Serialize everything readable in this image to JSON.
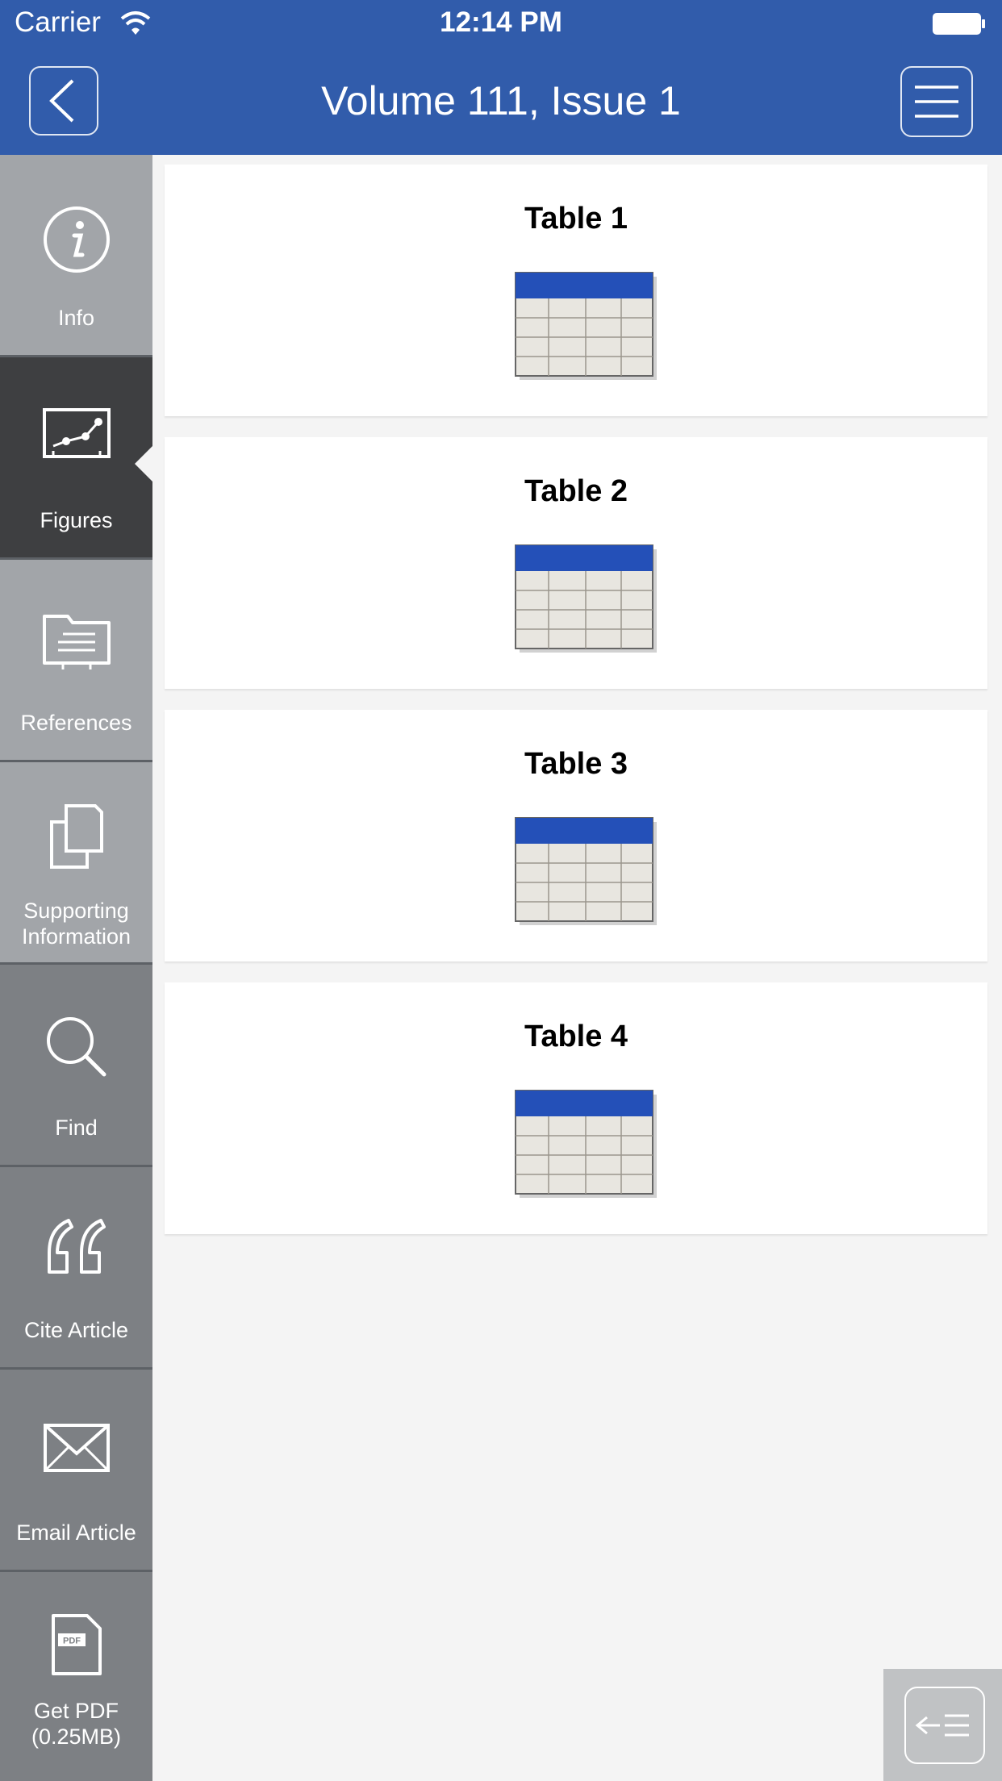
{
  "status_bar": {
    "carrier": "Carrier",
    "time": "12:14 PM"
  },
  "nav": {
    "title": "Volume 111, Issue 1",
    "back_icon": "chevron-left-icon",
    "menu_icon": "hamburger-menu-icon"
  },
  "sidebar": {
    "items": [
      {
        "label": "Info",
        "icon": "info-icon",
        "selected": false
      },
      {
        "label": "Figures",
        "icon": "chart-icon",
        "selected": true
      },
      {
        "label": "References",
        "icon": "folder-icon",
        "selected": false
      },
      {
        "label_line1": "Supporting",
        "label_line2": "Information",
        "icon": "documents-icon",
        "selected": false
      },
      {
        "label": "Find",
        "icon": "search-icon",
        "selected": false
      },
      {
        "label": "Cite Article",
        "icon": "quote-icon",
        "selected": false
      },
      {
        "label": "Email Article",
        "icon": "envelope-icon",
        "selected": false
      },
      {
        "label_line1": "Get PDF",
        "label_line2": "(0.25MB)",
        "icon": "pdf-icon",
        "selected": false
      }
    ]
  },
  "figures": [
    {
      "title": "Table 1"
    },
    {
      "title": "Table 2"
    },
    {
      "title": "Table 3"
    },
    {
      "title": "Table 4"
    }
  ],
  "colors": {
    "nav_bg": "#315cab",
    "sidebar_light": "#a2a5a9",
    "sidebar_selected": "#3e3f41",
    "sidebar_mid": "#7d8084",
    "table_header": "#2450b8"
  },
  "toggle": {
    "icon": "collapse-sidebar-icon"
  }
}
